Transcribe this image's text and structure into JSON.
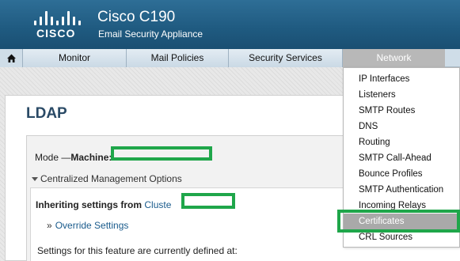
{
  "header": {
    "logo_text": "CISCO",
    "product": "Cisco C190",
    "subtitle": "Email Security Appliance"
  },
  "nav": {
    "home_icon": "home-icon",
    "tabs": [
      {
        "label": "Monitor"
      },
      {
        "label": "Mail Policies"
      },
      {
        "label": "Security Services"
      },
      {
        "label": "Network",
        "active": true
      }
    ]
  },
  "main": {
    "title": "LDAP",
    "mode_label": "Mode —",
    "machine_label": "Machine:",
    "centralized": "Centralized Management Options",
    "inheriting_label": "Inheriting settings from",
    "inheriting_link": "Cluste",
    "override": "Override Settings",
    "defined_text": "Settings for this feature are currently defined at:"
  },
  "network_menu": {
    "items": [
      "IP Interfaces",
      "Listeners",
      "SMTP Routes",
      "DNS",
      "Routing",
      "SMTP Call-Ahead",
      "Bounce Profiles",
      "SMTP Authentication",
      "Incoming Relays",
      "Certificates",
      "CRL Sources"
    ],
    "selected": "Certificates"
  },
  "colors": {
    "header": "#1f5a80",
    "highlight": "#1fa64a",
    "selected_item": "#a9a9a9",
    "title": "#2a4a66",
    "link": "#1a5b8c"
  }
}
